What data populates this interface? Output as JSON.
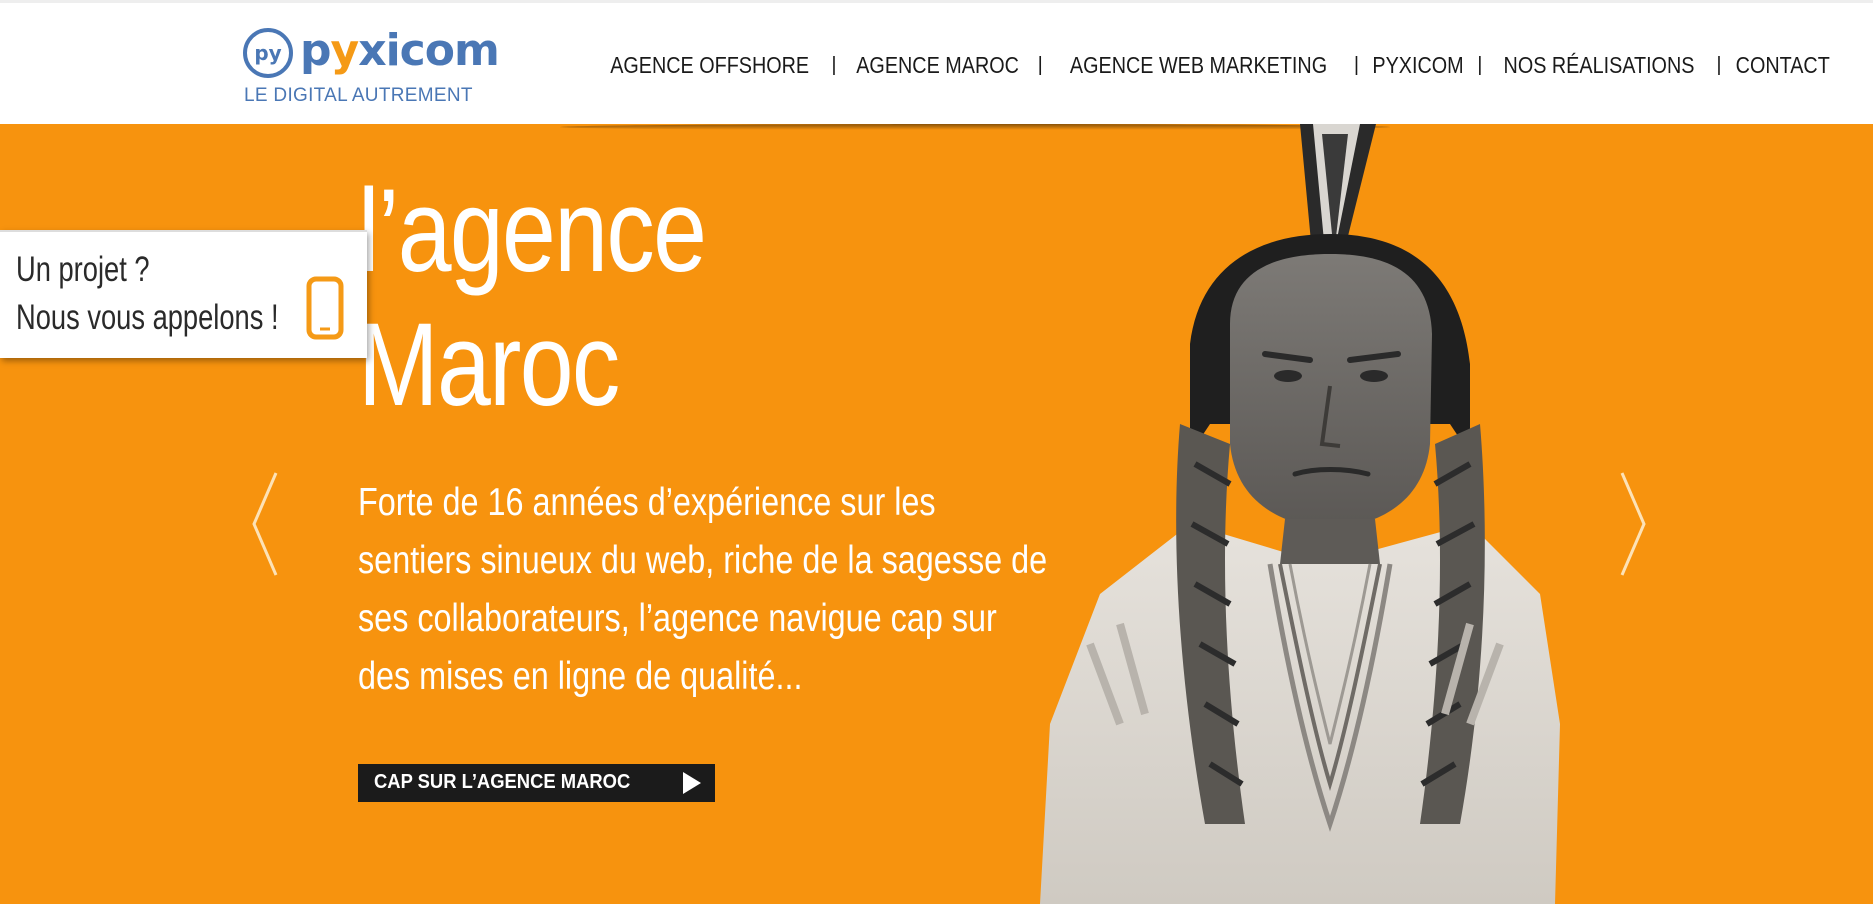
{
  "colors": {
    "brand_blue": "#4a77b5",
    "brand_orange": "#f59a16",
    "hero_bg": "#f7930e",
    "cta_bg": "#1b1b1b"
  },
  "logo": {
    "name_prefix": "p",
    "name_y": "y",
    "name_suffix": "xicom",
    "tagline": "LE DIGITAL AUTREMENT",
    "mark_icon": "py-circle-logo-icon"
  },
  "nav": {
    "items": [
      {
        "label": "AGENCE OFFSHORE"
      },
      {
        "label": "AGENCE MAROC"
      },
      {
        "label": "AGENCE WEB MARKETING"
      },
      {
        "label": "PYXICOM"
      },
      {
        "label": "NOS RÉALISATIONS"
      },
      {
        "label": "CONTACT"
      }
    ],
    "separator": "|"
  },
  "callback": {
    "line1": "Un projet ?",
    "line2": "Nous vous appelons !",
    "icon": "smartphone-icon"
  },
  "hero": {
    "title_line1": "l’agence",
    "title_line2": "Maroc",
    "text_lines": [
      "Forte de 16 années d’expérience sur les",
      "sentiers sinueux du web, riche de la sagesse de",
      "ses collaborateurs, l’agence navigue cap sur",
      "des mises en ligne de qualité..."
    ],
    "cta_label": "CAP SUR L’AGENCE MAROC",
    "cta_icon": "play-arrow-icon",
    "prev_icon": "chevron-left-icon",
    "next_icon": "chevron-right-icon",
    "image_icon": "chief-portrait-image"
  }
}
